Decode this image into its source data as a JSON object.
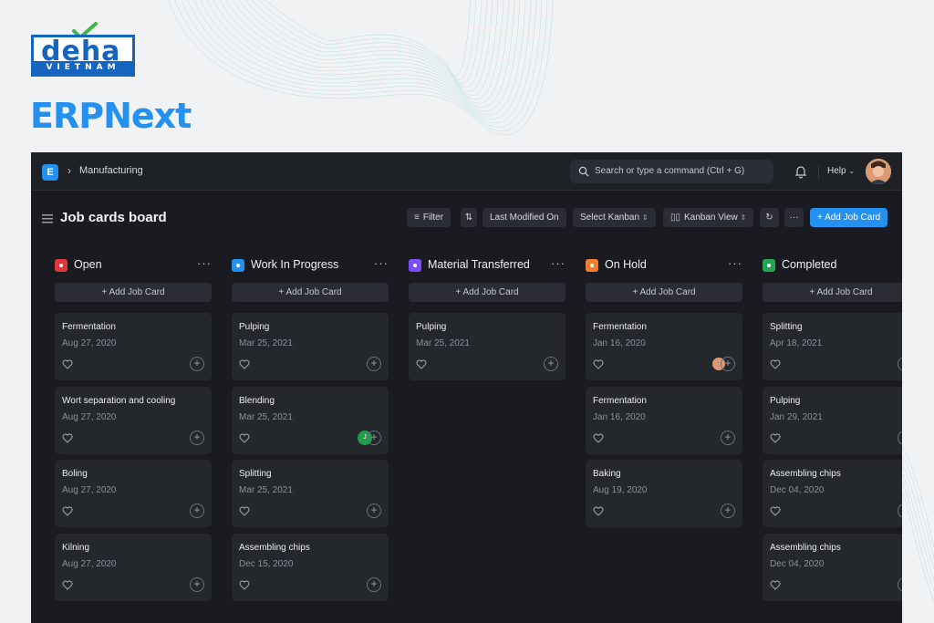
{
  "brand": {
    "logo_word": "deha",
    "logo_sub": "VIETNAM",
    "product": "ERPNext",
    "color": "#1565c0",
    "product_color": "#2490ef"
  },
  "navbar": {
    "app_icon": "E",
    "breadcrumb": "Manufacturing",
    "search_placeholder": "Search or type a command (Ctrl + G)",
    "help_label": "Help",
    "icons": [
      "search-icon",
      "bell-icon",
      "chevron-down-icon",
      "avatar"
    ]
  },
  "page": {
    "title": "Job cards board",
    "toolbar": {
      "filter": "Filter",
      "sort": "Last Modified On",
      "select_kanban": "Select Kanban",
      "kanban_view": "Kanban View",
      "more": "···",
      "add": "+ Add Job Card"
    }
  },
  "columns": [
    {
      "title": "Open",
      "color": "#e03636",
      "add_label": "+ Add Job Card",
      "cards": [
        {
          "title": "Fermentation",
          "date": "Aug 27, 2020"
        },
        {
          "title": "Wort separation and cooling",
          "date": "Aug 27, 2020"
        },
        {
          "title": "Boling",
          "date": "Aug 27, 2020"
        },
        {
          "title": "Kilning",
          "date": "Aug 27, 2020"
        }
      ]
    },
    {
      "title": "Work In Progress",
      "color": "#2490ef",
      "add_label": "+ Add Job Card",
      "cards": [
        {
          "title": "Pulping",
          "date": "Mar 25, 2021"
        },
        {
          "title": "Blending",
          "date": "Mar 25, 2021",
          "assignee": "J"
        },
        {
          "title": "Splitting",
          "date": "Mar 25, 2021"
        },
        {
          "title": "Assembling chips",
          "date": "Dec 15, 2020"
        }
      ]
    },
    {
      "title": "Material Transferred",
      "color": "#7c4dff",
      "add_label": "+ Add Job Card",
      "cards": [
        {
          "title": "Pulping",
          "date": "Mar 25, 2021"
        }
      ]
    },
    {
      "title": "On Hold",
      "color": "#f57c2c",
      "add_label": "+ Add Job Card",
      "cards": [
        {
          "title": "Fermentation",
          "date": "Jan 16, 2020",
          "assignee": "photo"
        },
        {
          "title": "Fermentation",
          "date": "Jan 16, 2020"
        },
        {
          "title": "Baking",
          "date": "Aug 19, 2020"
        }
      ]
    },
    {
      "title": "Completed",
      "color": "#23a455",
      "add_label": "+ Add Job Card",
      "cards": [
        {
          "title": "Splitting",
          "date": "Apr 18, 2021"
        },
        {
          "title": "Pulping",
          "date": "Jan 29, 2021"
        },
        {
          "title": "Assembling chips",
          "date": "Dec 04, 2020"
        },
        {
          "title": "Assembling chips",
          "date": "Dec 04, 2020"
        }
      ]
    }
  ]
}
